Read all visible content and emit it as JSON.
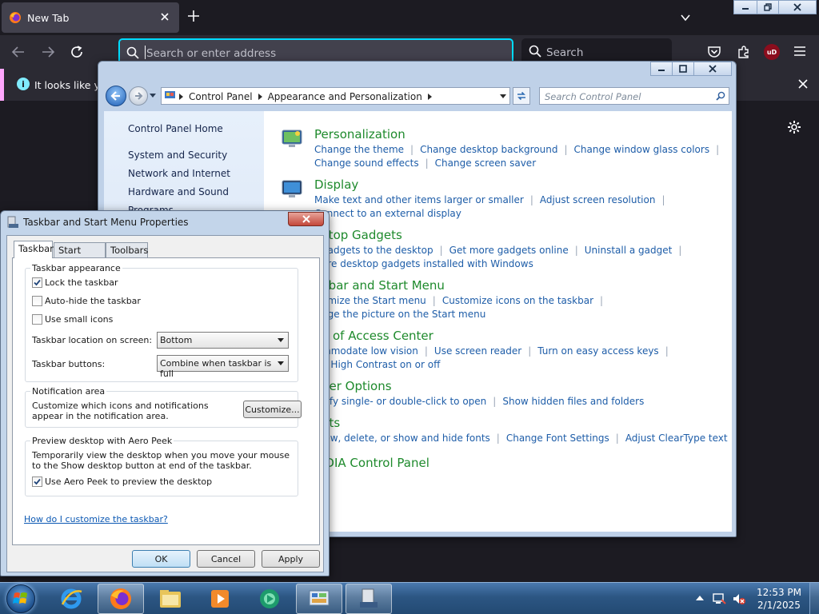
{
  "firefox": {
    "tab_title": "New Tab",
    "urlbar_placeholder": "Search or enter address",
    "search_label": "Search",
    "notice_text": "It looks like you",
    "ublock_label": "uD"
  },
  "control_panel": {
    "breadcrumbs": [
      "Control Panel",
      "Appearance and Personalization"
    ],
    "search_placeholder": "Search Control Panel",
    "left_links": [
      "Control Panel Home",
      "System and Security",
      "Network and Internet",
      "Hardware and Sound",
      "Programs"
    ],
    "categories": [
      {
        "title": "Personalization",
        "links": [
          [
            "Change the theme",
            "Change desktop background",
            "Change window glass colors"
          ],
          [
            "Change sound effects",
            "Change screen saver"
          ]
        ]
      },
      {
        "title": "Display",
        "links": [
          [
            "Make text and other items larger or smaller",
            "Adjust screen resolution"
          ],
          [
            "Connect to an external display"
          ]
        ]
      },
      {
        "title": "ktop Gadgets",
        "links": [
          [
            "gadgets to the desktop",
            "Get more gadgets online",
            "Uninstall a gadget"
          ],
          [
            "ore desktop gadgets installed with Windows"
          ]
        ]
      },
      {
        "title": "kbar and Start Menu",
        "links": [
          [
            "omize the Start menu",
            "Customize icons on the taskbar"
          ],
          [
            "nge the picture on the Start menu"
          ]
        ]
      },
      {
        "title": "e of Access Center",
        "links": [
          [
            "mmodate low vision",
            "Use screen reader",
            "Turn on easy access keys"
          ],
          [
            "n High Contrast on or off"
          ]
        ]
      },
      {
        "title": "der Options",
        "links": [
          [
            "cify single- or double-click to open",
            "Show hidden files and folders"
          ]
        ]
      },
      {
        "title": "nts",
        "links": [
          [
            "iew, delete, or show and hide fonts",
            "Change Font Settings",
            "Adjust ClearType text"
          ]
        ]
      },
      {
        "title": "IDIA Control Panel",
        "links": []
      }
    ]
  },
  "taskbar_props": {
    "title": "Taskbar and Start Menu Properties",
    "tabs": [
      "Taskbar",
      "Start Menu",
      "Toolbars"
    ],
    "appearance_title": "Taskbar appearance",
    "lock_label": "Lock the taskbar",
    "lock_checked": true,
    "autohide_label": "Auto-hide the taskbar",
    "autohide_checked": false,
    "small_icons_label": "Use small icons",
    "small_icons_checked": false,
    "location_label": "Taskbar location on screen:",
    "location_value": "Bottom",
    "buttons_label": "Taskbar buttons:",
    "buttons_value": "Combine when taskbar is full",
    "notif_title": "Notification area",
    "notif_text": "Customize which icons and notifications appear in the notification area.",
    "customize_label": "Customize...",
    "peek_title": "Preview desktop with Aero Peek",
    "peek_text": "Temporarily view the desktop when you move your mouse to the Show desktop button at end of the taskbar.",
    "peek_label": "Use Aero Peek to preview the desktop",
    "peek_checked": true,
    "help_link": "How do I customize the taskbar?",
    "ok_label": "OK",
    "cancel_label": "Cancel",
    "apply_label": "Apply"
  },
  "taskbar": {
    "time": "12:53 PM",
    "date": "2/1/2025"
  },
  "colors": {
    "accent_cyan": "#00ddff",
    "link_blue": "#1e5da8",
    "category_green": "#1e8a2c"
  }
}
